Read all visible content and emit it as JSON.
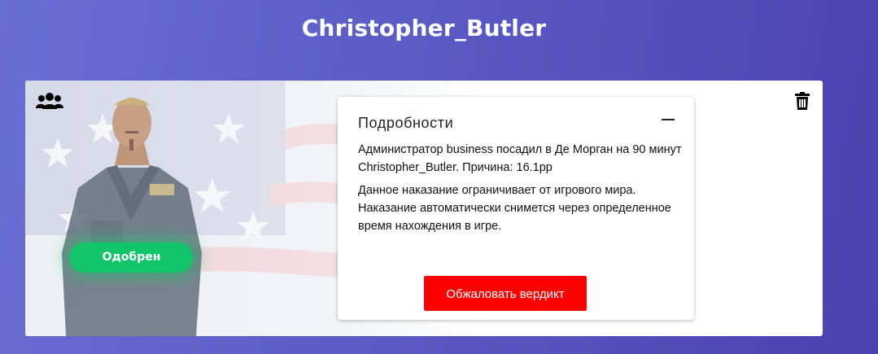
{
  "header": {
    "title": "Christopher_Butler"
  },
  "card": {
    "status_label": "Одобрен",
    "status_color": "#12c46a",
    "icons": {
      "left": "people-icon",
      "right": "trash-icon"
    },
    "details": {
      "title": "Подробности",
      "text1": "Администратор business посадил в Де Морган на 90 минут Christopher_Butler. Причина: 16.1рр",
      "text2": "Данное наказание ограничивает от игрового мира. Наказание автоматически снимется через определенное время нахождения в игре.",
      "appeal_label": "Обжаловать вердикт",
      "appeal_color": "#ff0000"
    }
  }
}
